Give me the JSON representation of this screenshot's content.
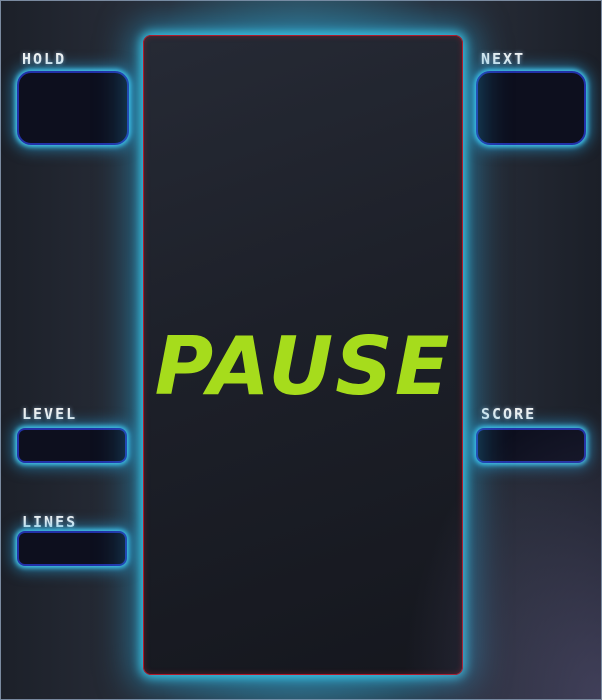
{
  "board": {
    "status_text": "PAUSE"
  },
  "panels": {
    "hold": {
      "label": "HOLD"
    },
    "next": {
      "label": "NEXT"
    },
    "level": {
      "label": "LEVEL",
      "value": ""
    },
    "score": {
      "label": "SCORE",
      "value": ""
    },
    "lines": {
      "label": "LINES",
      "value": ""
    }
  },
  "colors": {
    "pause_text": "#a6dc1c",
    "glow": "#3cd2f5",
    "board_border": "#b01c2c",
    "box_border": "#2231a8"
  }
}
